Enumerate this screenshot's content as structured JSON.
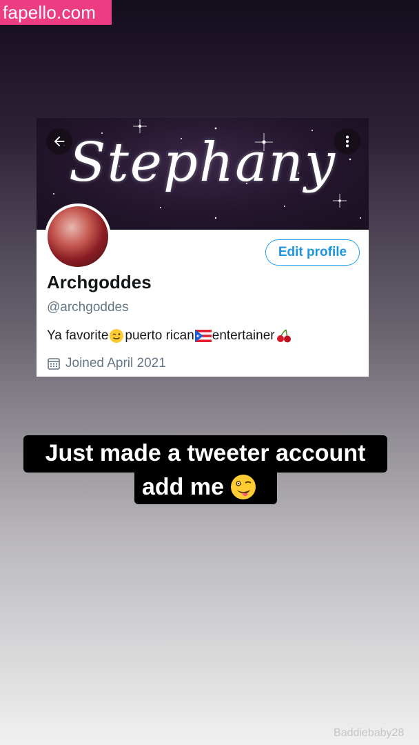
{
  "watermark": {
    "text": "fapello.com",
    "color": "#ec3d83"
  },
  "profile_card": {
    "banner": {
      "text": "Stephany"
    },
    "back_icon": "arrow-left-icon",
    "more_icon": "more-vertical-icon",
    "edit_profile_label": "Edit profile",
    "display_name": "Archgoddes",
    "handle": "@archgoddes",
    "bio": {
      "part1": "Ya favorite",
      "emoji1": "winking-face-emoji",
      "part2": "puerto rican",
      "emoji2": "puerto-rico-flag-emoji",
      "part3": "entertainer",
      "emoji3": "cherries-emoji"
    },
    "joined": "Joined April 2021",
    "joined_icon": "calendar-icon",
    "accent_color": "#1da1f2"
  },
  "caption": {
    "line1": "Just made a tweeter account",
    "line2": "add me",
    "emoji": "winking-tongue-face-emoji"
  },
  "user_tag": "Baddiebaby28"
}
